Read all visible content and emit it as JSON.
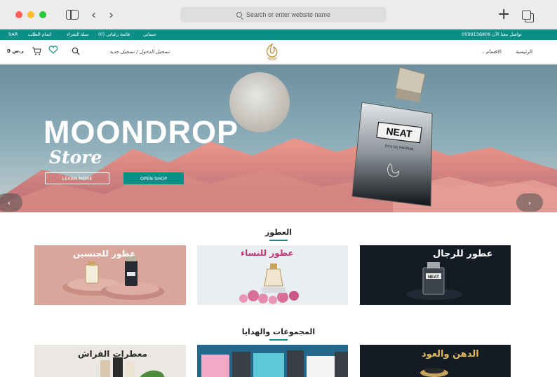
{
  "browser": {
    "address_placeholder": "Search or enter website name",
    "back_icon": "chevron-left-icon",
    "forward_icon": "chevron-right-icon"
  },
  "topbar": {
    "contact": "تواصل معنا الآن 0599136806",
    "links": [
      "حسابي",
      "قائمة رغباتي (0)",
      "سلة الشراء",
      "اتمام الطلب"
    ],
    "currency": "SAR"
  },
  "header": {
    "cart_total": "0 ر.س",
    "auth": "تسجيل الدخول / تسجيل جديد",
    "nav": [
      "الرئيسية",
      "الاقسام"
    ]
  },
  "hero": {
    "title": "MOONDROP",
    "subtitle": "Store",
    "learn_more": "LEARN MORE",
    "open_shop": "OPEN SHOP",
    "bottle_label": "NEAT",
    "bottle_sub": "EAU DE PARFUM",
    "prev": "‹",
    "next": "›"
  },
  "sections": {
    "perfumes_title": "العطور",
    "collections_title": "المجموعات والهدايا"
  },
  "categories": [
    {
      "label": "عطور للجنسين"
    },
    {
      "label": "عطور للنساء"
    },
    {
      "label": "عطور للرجال"
    }
  ],
  "collections": [
    {
      "label": "معطرات الفراش"
    },
    {
      "label": ""
    },
    {
      "label": "الدهن والعود"
    }
  ],
  "colors": {
    "accent": "#0b8f87",
    "dark_card": "#141a24"
  }
}
